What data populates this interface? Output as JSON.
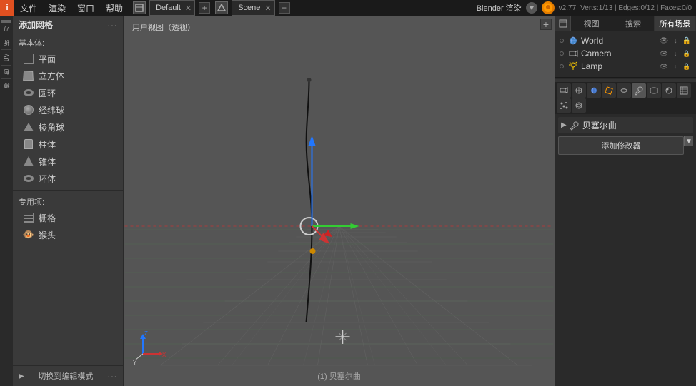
{
  "topbar": {
    "icon_label": "i",
    "menus": [
      "文件",
      "渲染",
      "窗口",
      "帮助"
    ],
    "editor_tab1": "Default",
    "editor_tab2": "Scene",
    "renderer_label": "Blender 渲染",
    "version": "v2.77",
    "stats": "Verts:1/13 | Edges:0/12 | Faces:0/0"
  },
  "left_panel": {
    "header": "添加网格",
    "dots": "···",
    "basic_label": "基本体:",
    "items": [
      {
        "id": "plane",
        "label": "平面",
        "icon": "plane"
      },
      {
        "id": "cube",
        "label": "立方体",
        "icon": "cube"
      },
      {
        "id": "circle",
        "label": "圆环",
        "icon": "torus"
      },
      {
        "id": "uvsphere",
        "label": "经纬球",
        "icon": "uvsphere"
      },
      {
        "id": "icosphere",
        "label": "棱角球",
        "icon": "icosphere"
      },
      {
        "id": "cylinder",
        "label": "柱体",
        "icon": "cylinder"
      },
      {
        "id": "cone",
        "label": "锥体",
        "icon": "cone"
      },
      {
        "id": "torus",
        "label": "环体",
        "icon": "torus2"
      }
    ],
    "special_label": "专用项:",
    "special_items": [
      {
        "id": "grid",
        "label": "栅格",
        "icon": "grid"
      },
      {
        "id": "monkey",
        "label": "猴头",
        "icon": "monkey"
      }
    ],
    "bottom_label": "切换到编辑模式",
    "bottom_dots": "···"
  },
  "viewport": {
    "label": "用户视图（透视）",
    "bottom_label": "(1) 贝塞尔曲"
  },
  "right_panel": {
    "top_tabs": [
      "视图",
      "搜索",
      "所有场景"
    ],
    "scene_items": [
      {
        "label": "World",
        "icon": "🌍",
        "type": "world"
      },
      {
        "label": "Camera",
        "icon": "📷",
        "type": "camera"
      },
      {
        "label": "Lamp",
        "icon": "💡",
        "type": "lamp"
      }
    ],
    "prop_tabs": [
      "cam",
      "mesh",
      "mat",
      "tex",
      "part",
      "phy",
      "ren",
      "scn",
      "wld",
      "obj",
      "con",
      "mod",
      "dat"
    ],
    "modifier_header": "贝塞尔曲",
    "add_modifier_label": "添加修改器"
  }
}
